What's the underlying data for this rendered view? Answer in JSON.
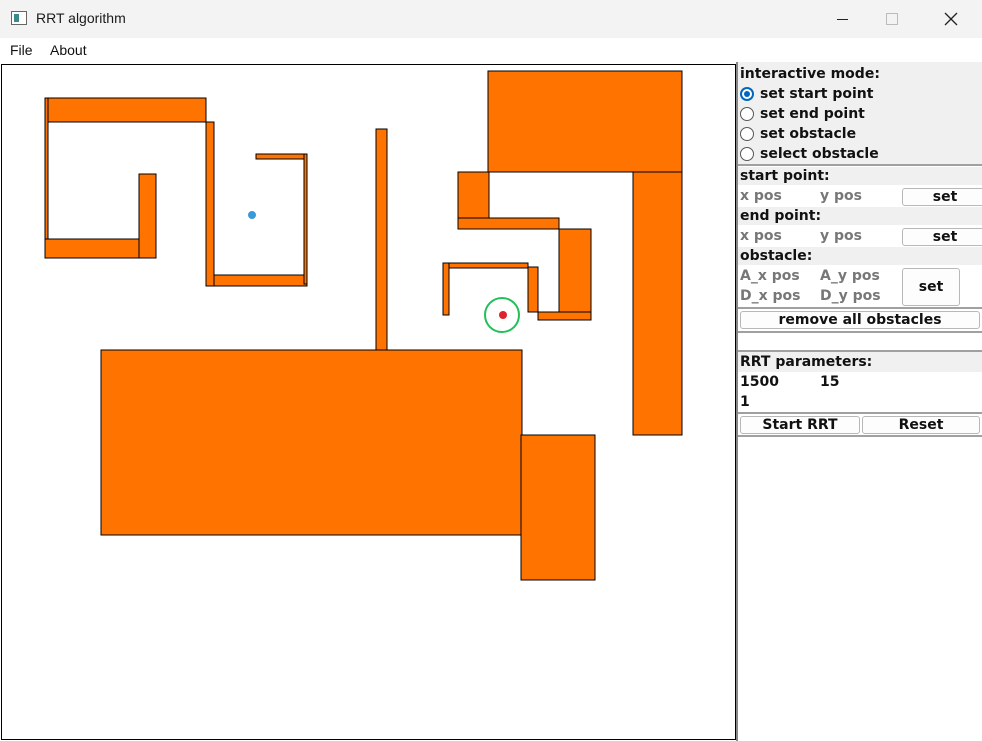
{
  "window": {
    "title": "RRT algorithm"
  },
  "menu": {
    "file": "File",
    "about": "About"
  },
  "colors": {
    "obstacle": "#ff7300",
    "start": "#3a9ad9",
    "end": "#e0222a",
    "goal_ring": "#22c05a"
  },
  "panel": {
    "interactive_mode": {
      "header": "interactive mode:",
      "options": [
        {
          "label": "set start point",
          "selected": true
        },
        {
          "label": "set end point",
          "selected": false
        },
        {
          "label": "set obstacle",
          "selected": false
        },
        {
          "label": "select obstacle",
          "selected": false
        }
      ]
    },
    "start_point": {
      "header": "start point:",
      "x": "x pos",
      "y": "y pos",
      "button": "set"
    },
    "end_point": {
      "header": "end point:",
      "x": "x pos",
      "y": "y pos",
      "button": "set"
    },
    "obstacle": {
      "header": "obstacle:",
      "ax": "A_x pos",
      "ay": "A_y pos",
      "dx": "D_x pos",
      "dy": "D_y pos",
      "button": "set"
    },
    "remove_all": "remove all obstacles",
    "rrt": {
      "header": "RRT parameters:",
      "v1": "1500",
      "v2": "15",
      "v3": "1"
    },
    "start_button": "Start RRT",
    "reset_button": "Reset"
  }
}
